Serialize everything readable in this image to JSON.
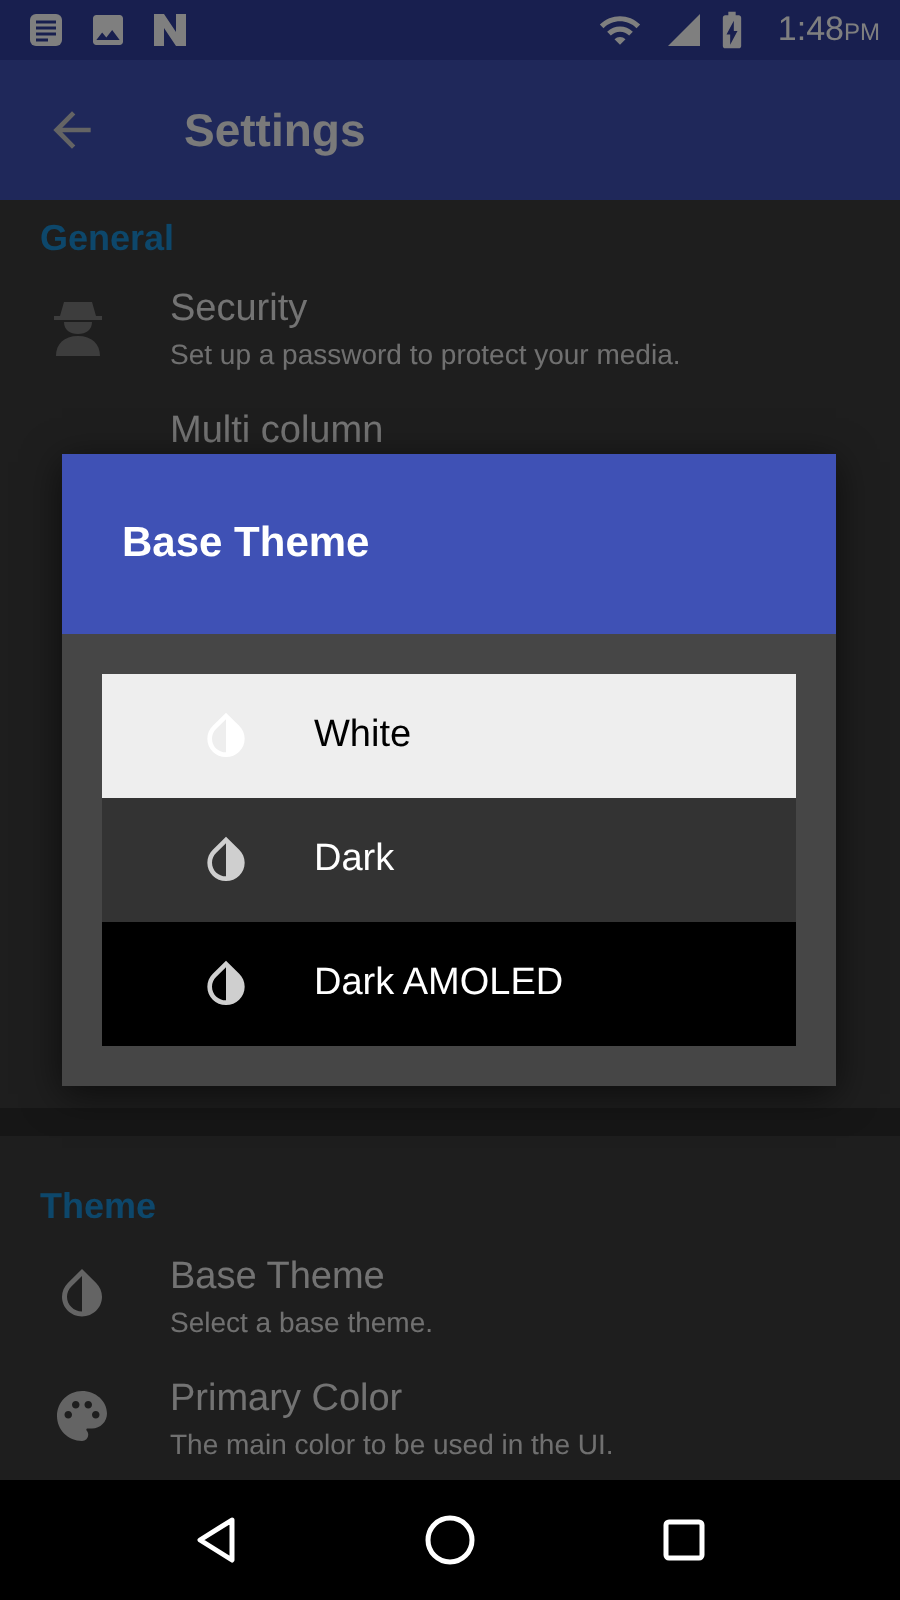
{
  "status_bar": {
    "time": "1:48",
    "meridiem": "PM"
  },
  "app_bar": {
    "title": "Settings"
  },
  "sections": [
    {
      "title": "General",
      "items": [
        {
          "kind": "spy",
          "title": "Security",
          "subtitle": "Set up a password to protect your media."
        },
        {
          "kind": "plain",
          "title": "Multi column"
        }
      ]
    },
    {
      "title": "Theme",
      "items": [
        {
          "kind": "drop",
          "title": "Base Theme",
          "subtitle": "Select a base theme."
        },
        {
          "kind": "palette",
          "title": "Primary Color",
          "subtitle": "The main color to be used in the UI."
        }
      ]
    }
  ],
  "dialog": {
    "title": "Base Theme",
    "options": [
      {
        "kind": "white",
        "label": "White"
      },
      {
        "kind": "dark",
        "label": "Dark"
      },
      {
        "kind": "amoled",
        "label": "Dark AMOLED"
      }
    ]
  }
}
